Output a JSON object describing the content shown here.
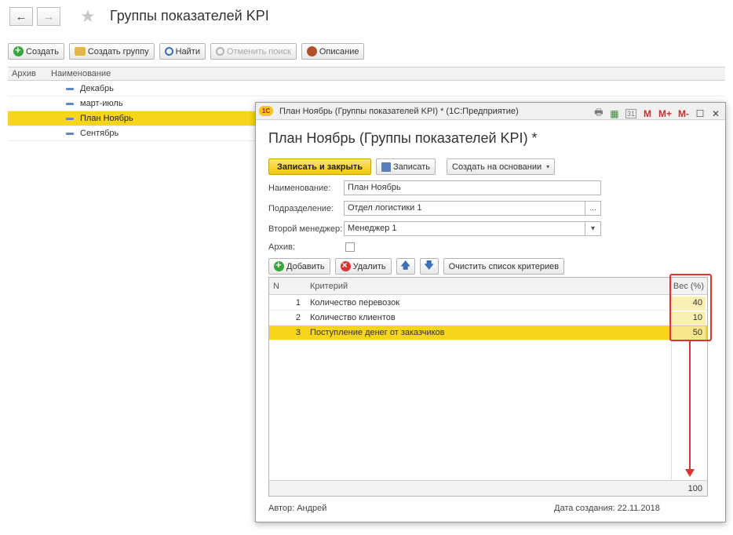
{
  "page": {
    "title": "Группы показателей KPI",
    "back_glyph": "←",
    "forward_glyph": "→",
    "star_glyph": "★"
  },
  "toolbar": {
    "create": "Создать",
    "create_group": "Создать группу",
    "find": "Найти",
    "cancel_search": "Отменить поиск",
    "description": "Описание"
  },
  "list": {
    "columns": [
      "Архив",
      "Наименование"
    ],
    "rows": [
      {
        "name": "Декабрь"
      },
      {
        "name": "март-июль"
      },
      {
        "name": "План Ноябрь",
        "selected": true
      },
      {
        "name": "Сентябрь"
      }
    ]
  },
  "window": {
    "logo": "1С",
    "title": "План Ноябрь (Группы показателей KPI) * (1С:Предприятие)",
    "icons": [
      "print-icon",
      "calculator-icon",
      "calendar-icon",
      "memory-m-icon",
      "memory-mplus-icon",
      "memory-mminus-icon",
      "restore-icon",
      "close-icon"
    ],
    "icon_glyphs": [
      "🖶",
      "▦",
      "31",
      "M",
      "M+",
      "M-",
      "☐",
      "✕"
    ]
  },
  "form": {
    "title": "План Ноябрь (Группы показателей KPI) *",
    "save_close": "Записать и закрыть",
    "save": "Записать",
    "create_based": "Создать на основании",
    "fields": {
      "name_label": "Наименование:",
      "name_value": "План Ноябрь",
      "department_label": "Подразделение:",
      "department_value": "Отдел логистики 1",
      "manager_label": "Второй менеджер:",
      "manager_value": "Менеджер 1",
      "archive_label": "Архив:"
    },
    "select_btn": "...",
    "dropdown_glyph": "▾"
  },
  "table_toolbar": {
    "add": "Добавить",
    "delete": "Удалить",
    "up_glyph": "🡅",
    "down_glyph": "🡇",
    "clear": "Очистить список критериев"
  },
  "grid": {
    "columns": [
      "N",
      "Критерий",
      "Вес (%)"
    ],
    "rows": [
      {
        "n": "1",
        "criterion": "Количество перевозок",
        "weight": "40"
      },
      {
        "n": "2",
        "criterion": "Количество клиентов",
        "weight": "10"
      },
      {
        "n": "3",
        "criterion": "Поступление денег от заказчиков",
        "weight": "50",
        "selected": true
      }
    ],
    "total": "100"
  },
  "footer": {
    "author": "Автор: Андрей",
    "created": "Дата создания: 22.11.2018"
  },
  "colors": {
    "selection": "#f7d51c",
    "annotation": "#e03030",
    "primary_button": "#f3c812"
  }
}
